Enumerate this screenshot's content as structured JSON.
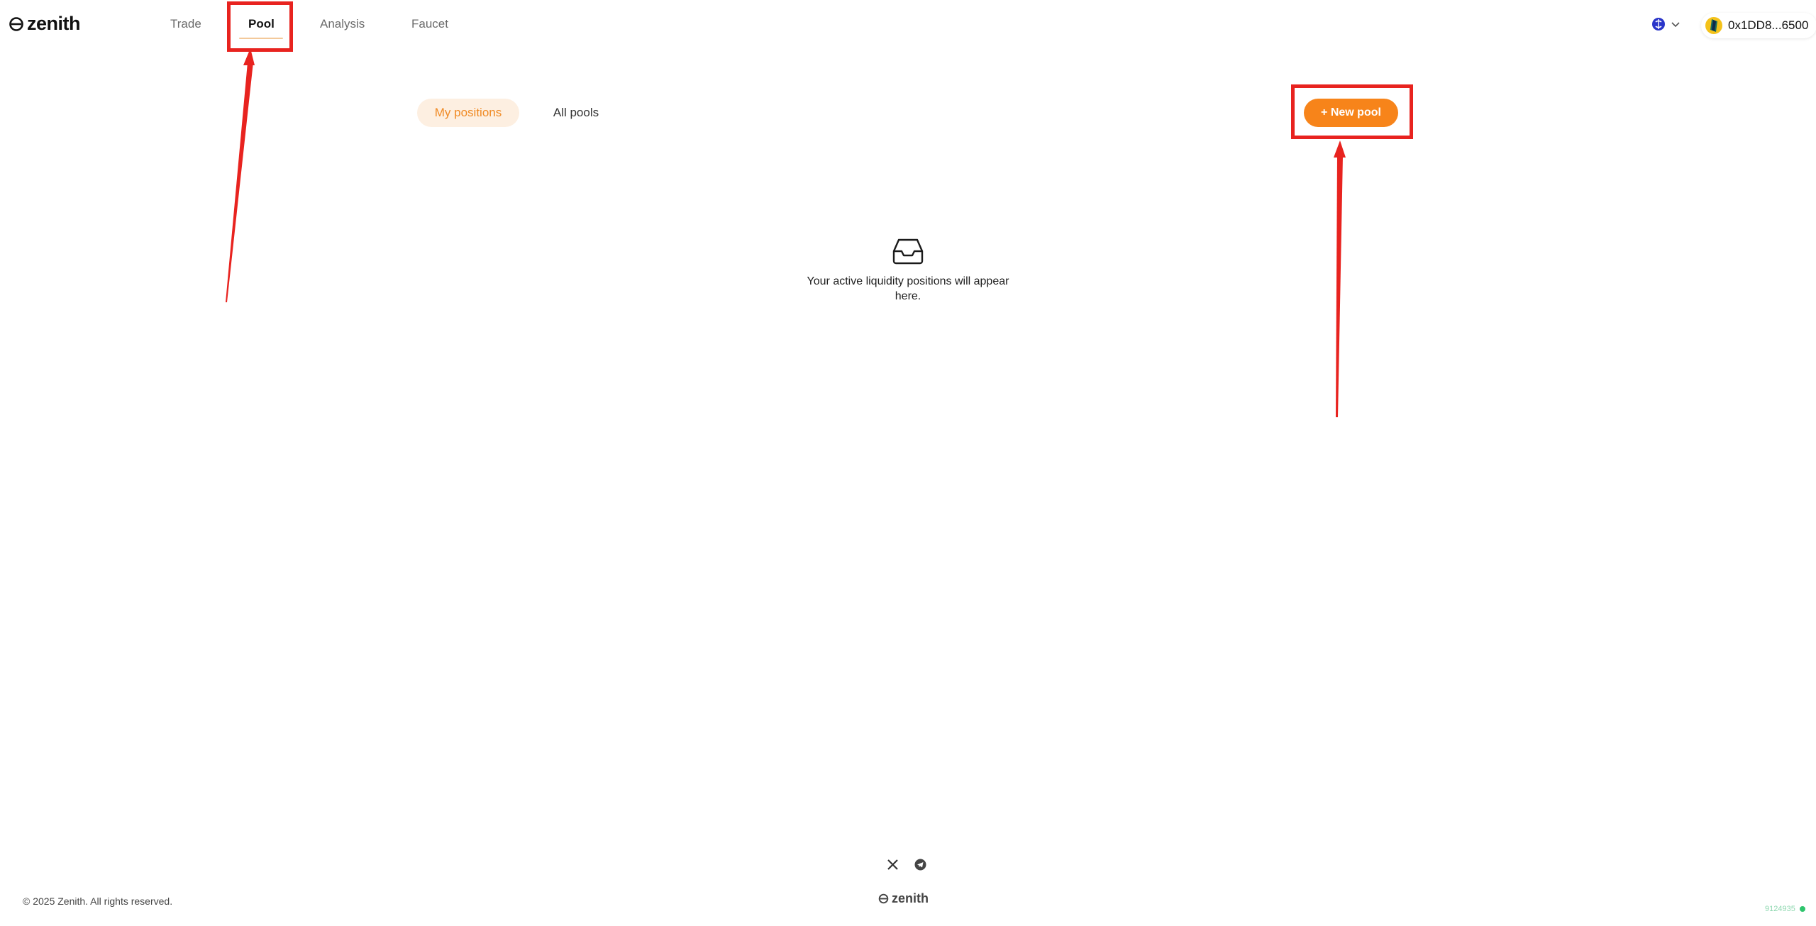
{
  "brand": {
    "name": "zenith"
  },
  "nav": {
    "items": [
      {
        "label": "Trade",
        "active": false
      },
      {
        "label": "Pool",
        "active": true
      },
      {
        "label": "Analysis",
        "active": false
      },
      {
        "label": "Faucet",
        "active": false
      }
    ]
  },
  "header": {
    "language_icon": "globe-icon",
    "wallet": {
      "address": "0x1DD8...6500"
    }
  },
  "tabs": [
    {
      "label": "My positions",
      "active": true
    },
    {
      "label": "All pools",
      "active": false
    }
  ],
  "actions": {
    "new_pool_label": "+ New pool"
  },
  "empty_state": {
    "icon": "inbox-icon",
    "message": "Your active liquidity positions will appear here."
  },
  "footer": {
    "social_icons": [
      "x-icon",
      "telegram-icon"
    ],
    "brand": "zenith",
    "copyright": "© 2025 Zenith. All rights reserved.",
    "build": "9124935"
  },
  "colors": {
    "accent": "#f7841a",
    "accent_soft": "#fdefe1",
    "annotation": "#e8231f",
    "status_ok": "#2ec46d"
  }
}
